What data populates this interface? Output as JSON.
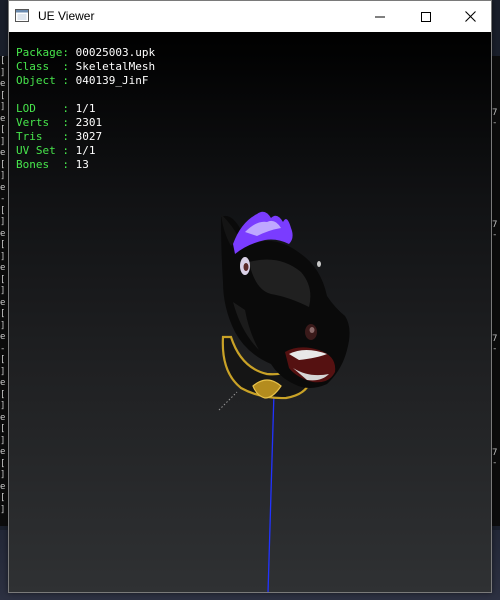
{
  "window": {
    "title": "UE Viewer",
    "background_color": "#000000"
  },
  "controls": {
    "minimize_icon": "minimize-icon",
    "maximize_icon": "maximize-icon",
    "close_icon": "close-icon"
  },
  "info": {
    "package_label": "Package: ",
    "package_value": "00025003.upk",
    "class_label": "Class  : ",
    "class_value": "SkeletalMesh",
    "object_label": "Object : ",
    "object_value": "040139_JinF",
    "lod_label": "LOD    : ",
    "lod_value": "1/1",
    "verts_label": "Verts  : ",
    "verts_value": "2301",
    "tris_label": "Tris   : ",
    "tris_value": "3027",
    "uvset_label": "UV Set : ",
    "uvset_value": "1/1",
    "bones_label": "Bones  : ",
    "bones_value": "13",
    "label_color": "#47e64c",
    "value_color": "#ffffff"
  },
  "background_console": {
    "left_chars": [
      "[",
      "]",
      "e",
      "[",
      "]",
      "e",
      "[",
      "]",
      "e",
      "[",
      "]",
      "e",
      "-",
      "[",
      "]",
      "e",
      "[",
      "]",
      "e",
      "[",
      "]",
      "e",
      "[",
      "]",
      "e",
      "-",
      "[",
      "]",
      "e",
      "[",
      "]",
      "e",
      "[",
      "]",
      "e",
      "[",
      "]",
      "e",
      "[",
      "]"
    ],
    "right_chars": [
      "7",
      "-",
      "7",
      "-",
      "7",
      "-",
      "7",
      "-"
    ]
  },
  "scene": {
    "mesh_name": "horse-head-mesh",
    "mane_color": "#7a3cff",
    "collar_color": "#c9a227",
    "bone_line_color": "#2233ff"
  }
}
